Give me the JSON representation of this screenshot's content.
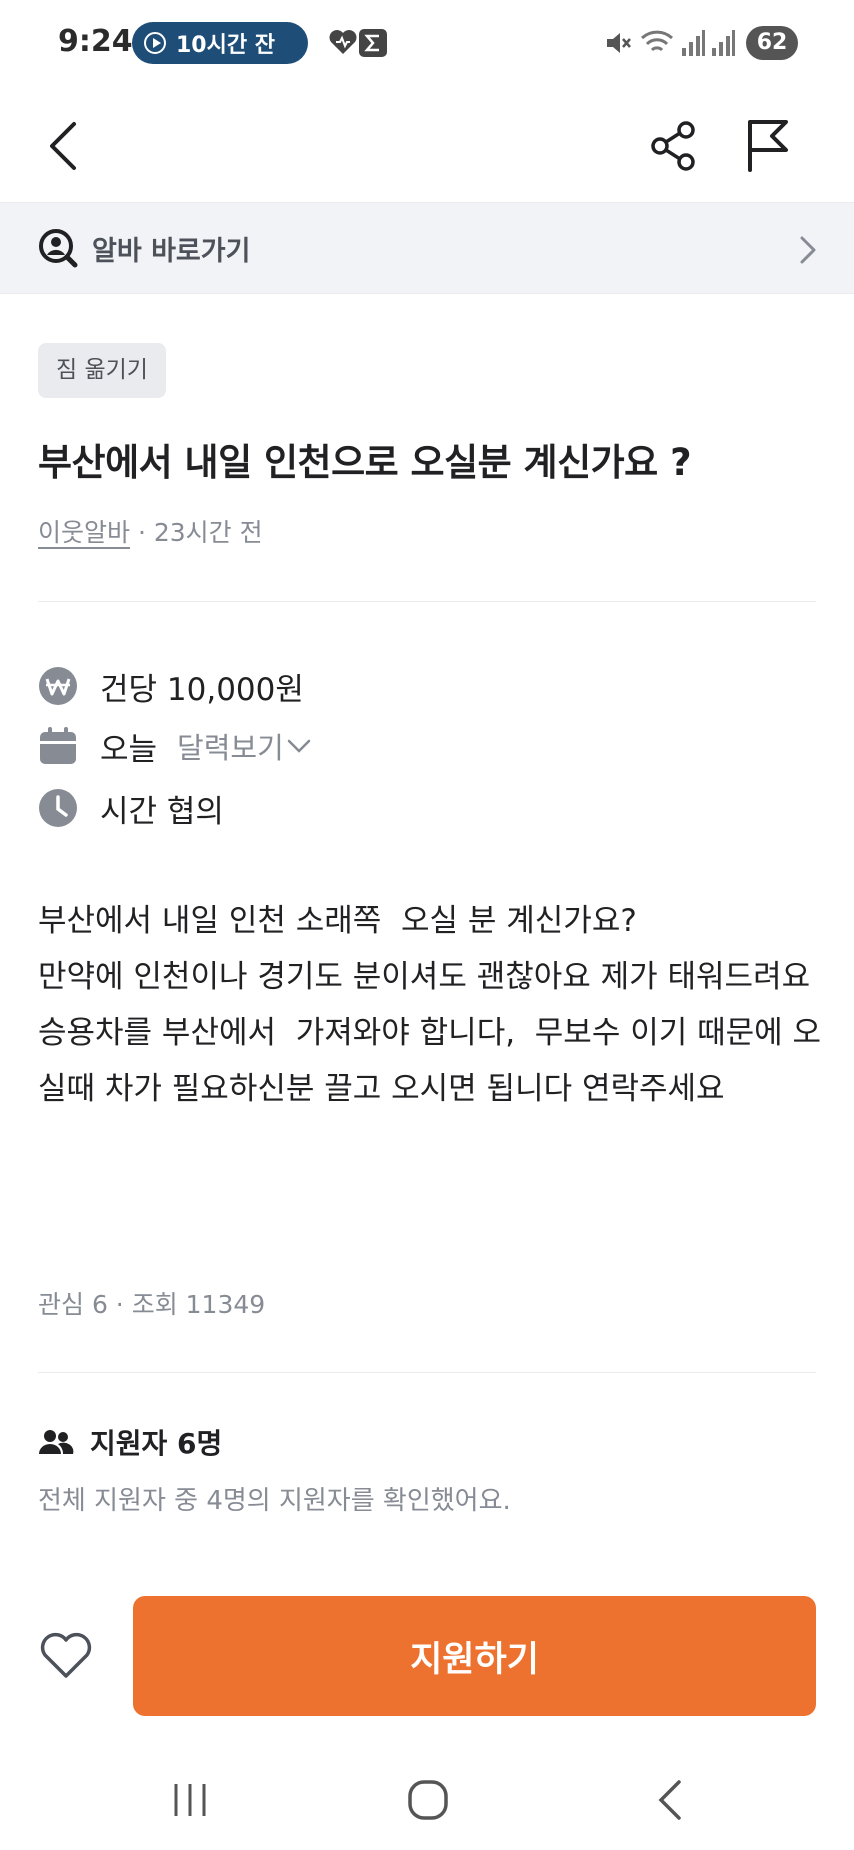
{
  "status_bar": {
    "time": "9:24",
    "pill_text": "10시간 잔",
    "battery": "62"
  },
  "shortcut": {
    "label": "알바 바로가기"
  },
  "post": {
    "category_tag": "짐 옮기기",
    "title": "부산에서 내일 인천으로 오실분 계신가요 ?",
    "author": "이웃알바",
    "separator": " · ",
    "time_ago": "23시간 전",
    "pay": "건당 10,000원",
    "date": "오늘",
    "calendar_link": "달력보기",
    "work_time": "시간 협의",
    "body": "부산에서 내일 인천 소래쪽  오실 분 계신가요?\n만약에 인천이나 경기도 분이셔도 괜찮아요 제가 태워드려요\n승용차를 부산에서  가져와야 합니다,  무보수 이기 때문에 오실때 차가 필요하신분 끌고 오시면 됩니다 연락주세요",
    "stats": "관심 6 · 조회 11349"
  },
  "applicants": {
    "label": "지원자 6명",
    "description": "전체 지원자 중 4명의 지원자를 확인했어요."
  },
  "actions": {
    "apply_label": "지원하기"
  },
  "colors": {
    "accent": "#ee722f",
    "status_pill": "#1e4d78",
    "banner_bg": "#f2f3f6",
    "muted_text": "#868b94",
    "icon_gray": "#868b94"
  }
}
